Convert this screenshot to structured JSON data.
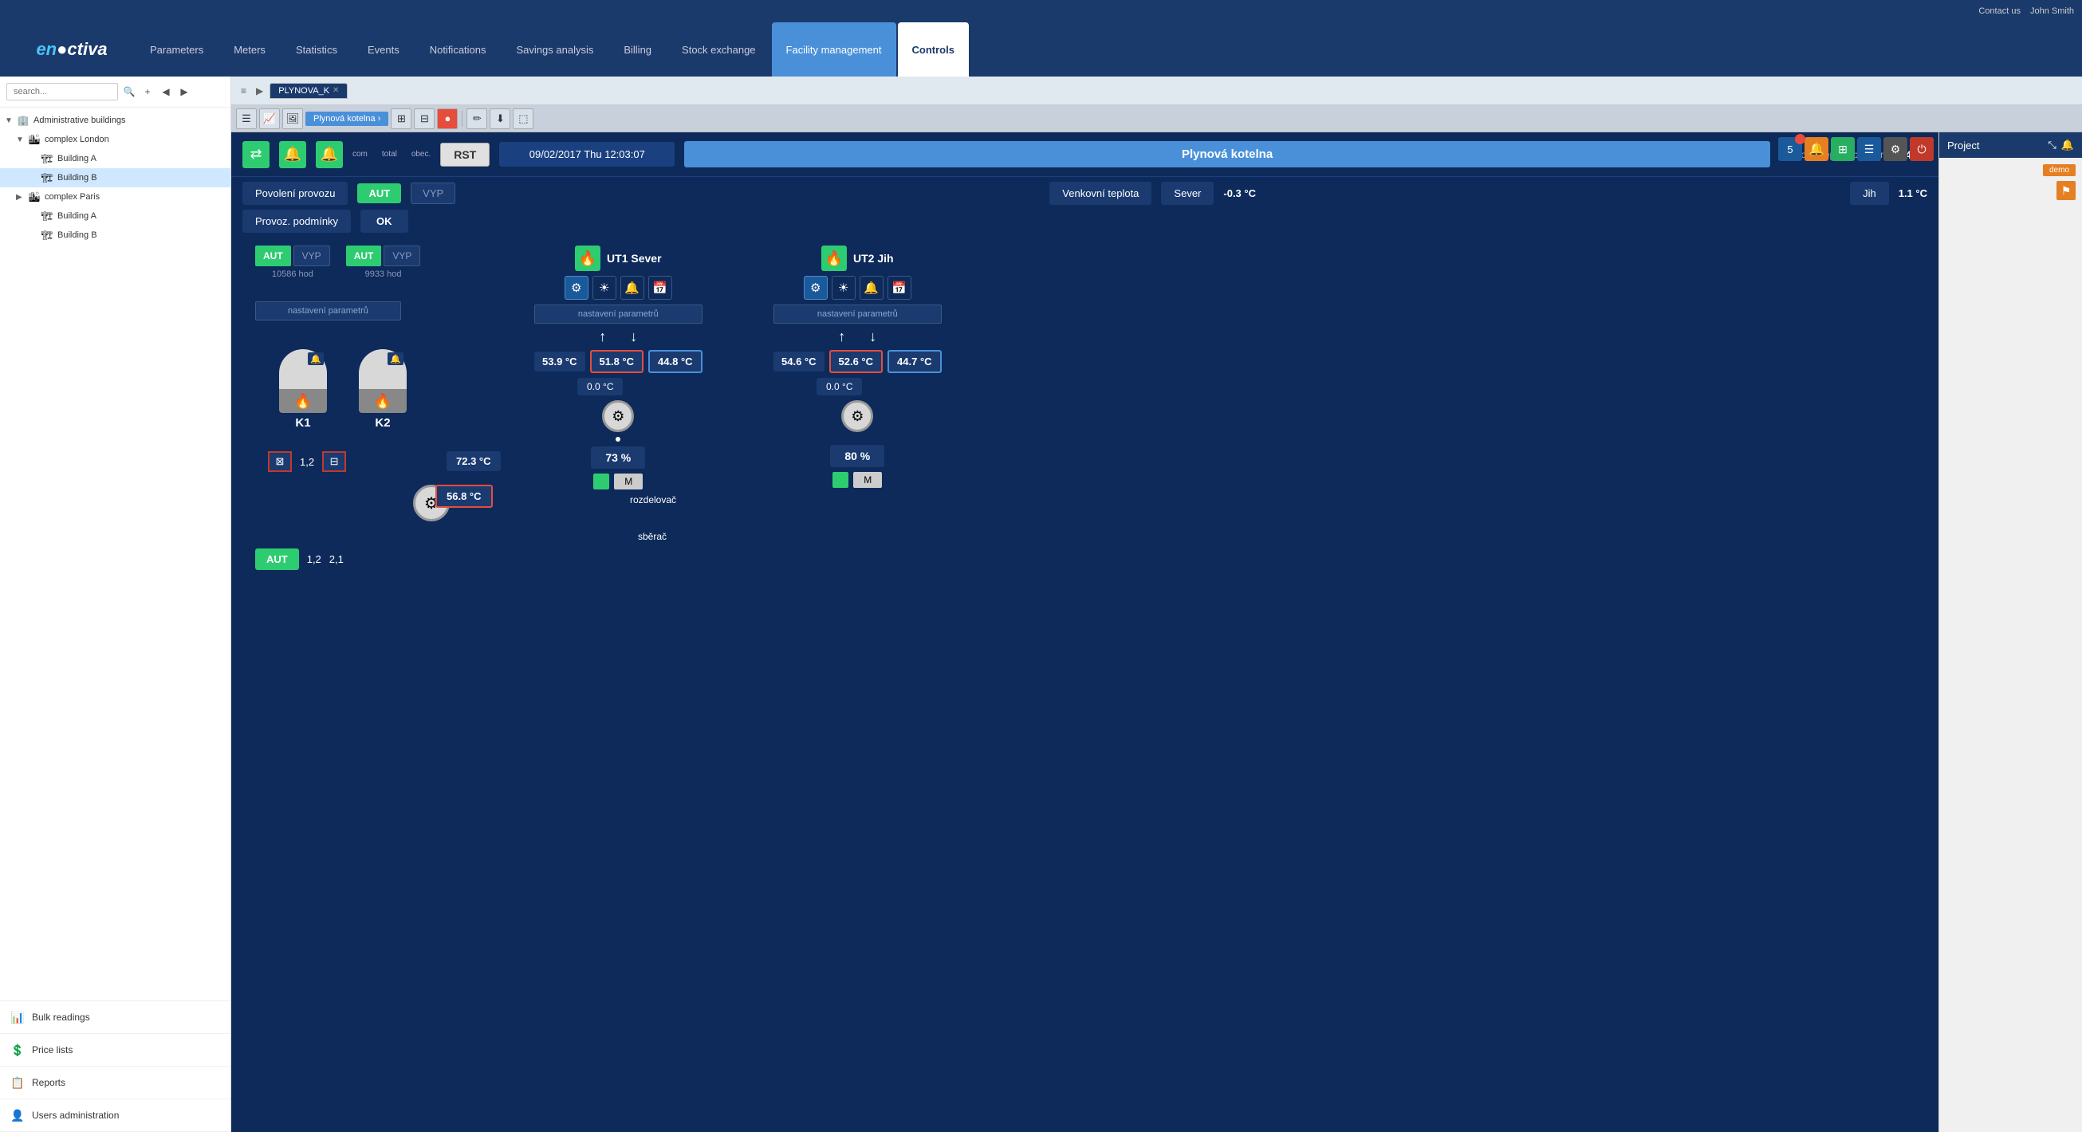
{
  "topbar": {
    "contact_label": "Contact us",
    "user_label": "John Smith"
  },
  "navbar": {
    "logo_text": "enectiva",
    "tabs": [
      {
        "id": "parameters",
        "label": "Parameters",
        "active": false
      },
      {
        "id": "meters",
        "label": "Meters",
        "active": false
      },
      {
        "id": "statistics",
        "label": "Statistics",
        "active": false
      },
      {
        "id": "events",
        "label": "Events",
        "active": false
      },
      {
        "id": "notifications",
        "label": "Notifications",
        "active": false
      },
      {
        "id": "savings",
        "label": "Savings analysis",
        "active": false
      },
      {
        "id": "billing",
        "label": "Billing",
        "active": false
      },
      {
        "id": "stock",
        "label": "Stock exchange",
        "active": false
      },
      {
        "id": "facility",
        "label": "Facility management",
        "active": false
      },
      {
        "id": "controls",
        "label": "Controls",
        "active": true
      }
    ]
  },
  "sidebar": {
    "search_placeholder": "search...",
    "tree": [
      {
        "id": "admin-buildings",
        "label": "Administrative buildings",
        "level": 0,
        "icon": "🏢",
        "expanded": true
      },
      {
        "id": "complex-london",
        "label": "complex London",
        "level": 1,
        "icon": "🏙️",
        "expanded": true
      },
      {
        "id": "building-a-london",
        "label": "Building A",
        "level": 2,
        "icon": "🏗️"
      },
      {
        "id": "building-b-london",
        "label": "Building B",
        "level": 2,
        "icon": "🏗️"
      },
      {
        "id": "complex-paris",
        "label": "complex Paris",
        "level": 1,
        "icon": "🏙️",
        "expanded": false
      },
      {
        "id": "building-a-paris",
        "label": "Building A",
        "level": 2,
        "icon": "🏗️"
      },
      {
        "id": "building-b-paris",
        "label": "Building B",
        "level": 2,
        "icon": "🏗️"
      }
    ],
    "footer_items": [
      {
        "id": "bulk-readings",
        "label": "Bulk readings",
        "icon": "📊"
      },
      {
        "id": "price-lists",
        "label": "Price lists",
        "icon": "💲"
      },
      {
        "id": "reports",
        "label": "Reports",
        "icon": "📋"
      },
      {
        "id": "users-admin",
        "label": "Users administration",
        "icon": "👤"
      }
    ]
  },
  "content": {
    "tab_arrow": "≡",
    "tabs": [
      {
        "id": "plynova",
        "label": "PLYNOVA_K",
        "active": true
      }
    ],
    "toolbar": {
      "breadcrumb": "Plynová kotelna ›",
      "buttons": [
        "☰",
        "📈",
        "🖼",
        "⚙",
        "📋",
        "🔴",
        "✏",
        "⬇",
        "⬚"
      ]
    },
    "status_bar": {
      "datetime": "09/02/2017 Thu 12:03:07",
      "title": "Plynová kotelna",
      "outdoor_label": "Venkovní teplota průměr",
      "outdoor_value": "0.4 °C"
    },
    "info_rows": {
      "povoleni_label": "Povolení provozu",
      "aut_label": "AUT",
      "vyp_label": "VYP",
      "provoz_label": "Provoz. podmínky",
      "ok_value": "OK",
      "venkovni_label": "Venkovní teplota",
      "sever_label": "Sever",
      "sever_value": "-0.3 °C",
      "jih_label": "Jih",
      "jih_value": "1.1 °C"
    },
    "left_controls": {
      "group1": {
        "aut": "AUT",
        "vyp": "VYP",
        "hours": "10586 hod"
      },
      "group2": {
        "aut": "AUT",
        "vyp": "VYP",
        "hours": "9933 hod"
      },
      "params_btn": "nastavení parametrů",
      "bottom_aut": "AUT",
      "bottom_val1": "1,2",
      "bottom_val2": "2,1"
    },
    "boilers": [
      {
        "id": "K1",
        "label": "K1"
      },
      {
        "id": "K2",
        "label": "K2"
      }
    ],
    "pump_label": "1,2",
    "ut1": {
      "title": "UT1 Sever",
      "params_btn": "nastavení parametrů",
      "temp1": "53.9 °C",
      "temp2_red": "51.8 °C",
      "temp3_blue": "44.8 °C",
      "temp4": "0.0 °C",
      "pct": "73 %",
      "arrow_up": "↑",
      "arrow_down": "↓"
    },
    "ut2": {
      "title": "UT2 Jih",
      "params_btn": "nastavení parametrů",
      "temp1": "54.6 °C",
      "temp2_red": "52.6 °C",
      "temp3_blue": "44.7 °C",
      "temp4": "0.0 °C",
      "pct": "80 %",
      "arrow_up": "↑",
      "arrow_down": "↓"
    },
    "main_temps": {
      "pump_temp_top": "72.3 °C",
      "pump_temp_red": "56.8 °C",
      "rozdelovac_label": "rozdelovač",
      "sberac_label": "sběrač"
    },
    "top_right_buttons": [
      {
        "label": "5",
        "type": "blue-badge"
      },
      {
        "label": "🔔",
        "type": "orange"
      },
      {
        "label": "⊞",
        "type": "green"
      },
      {
        "label": "☰",
        "type": "list"
      },
      {
        "label": "⚙",
        "type": "gear"
      },
      {
        "label": "⏻",
        "type": "red"
      }
    ],
    "right_panel": {
      "title": "Project",
      "demo_label": "demo"
    }
  },
  "colors": {
    "primary": "#1a3a6b",
    "accent": "#4a90d9",
    "green": "#2ecc71",
    "red": "#e74c3c",
    "scada_bg": "#0d2a5a",
    "pipe_red": "#c0392b",
    "pipe_blue": "#4a90d9"
  }
}
